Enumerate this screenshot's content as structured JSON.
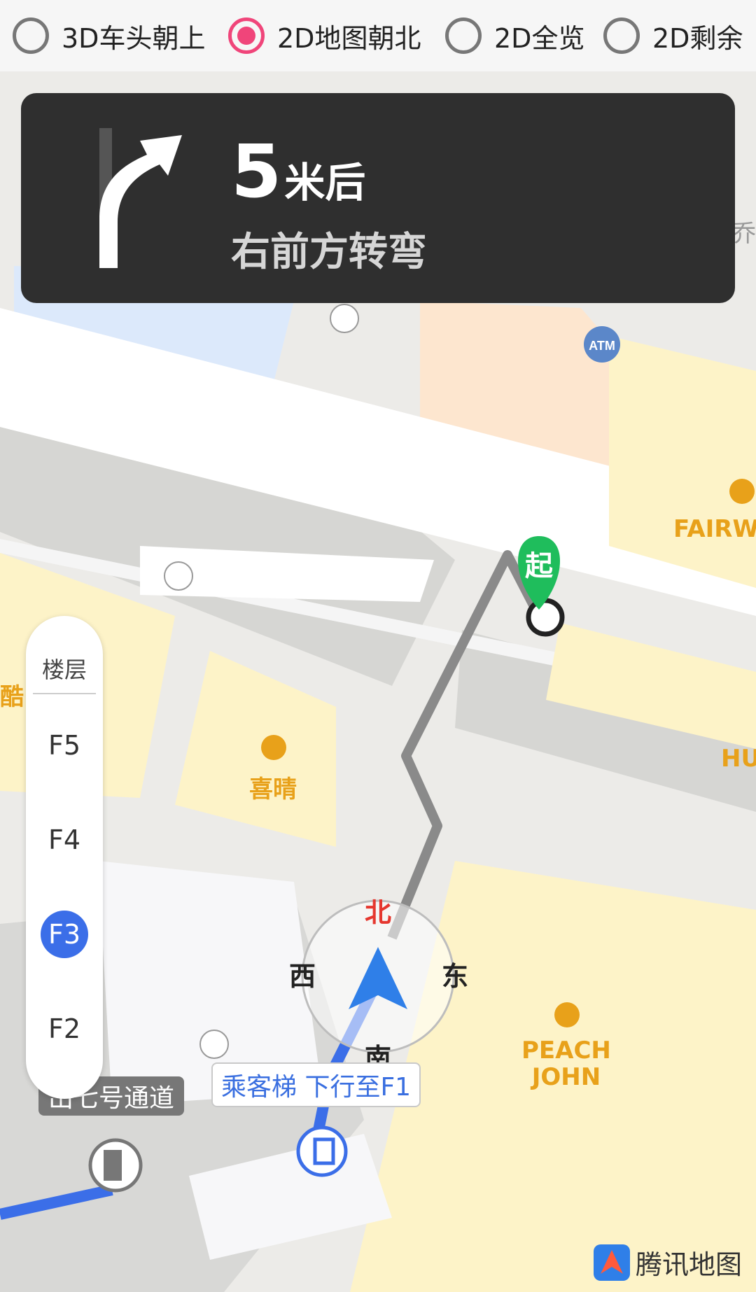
{
  "view_modes": [
    {
      "label": "3D车头朝上",
      "checked": false
    },
    {
      "label": "2D地图朝北",
      "checked": true
    },
    {
      "label": "2D全览",
      "checked": false
    },
    {
      "label": "2D剩余",
      "checked": false
    }
  ],
  "navigation": {
    "distance_value": "5",
    "distance_unit": "米后",
    "instruction": "右前方转弯",
    "maneuver_icon": "turn-slight-right-arrow-icon"
  },
  "floor_selector": {
    "title": "楼层",
    "floors": [
      "F5",
      "F4",
      "F3",
      "F2"
    ],
    "active": "F3"
  },
  "map": {
    "start_marker": "起",
    "compass": {
      "north": "北",
      "east": "东",
      "south": "南",
      "west": "西"
    },
    "elevator_callout": "乘客梯 下行至F1",
    "exit_callout": "出七号通道",
    "shops": [
      {
        "name": "FAIRWI"
      },
      {
        "name": "喜晴"
      },
      {
        "name": "PEACH\nJOHN"
      },
      {
        "name": "HU"
      }
    ],
    "edge_labels": [
      "酷",
      "乔"
    ],
    "atm_label": "ATM",
    "brand": "腾讯地图"
  },
  "colors": {
    "accent_radio": "#f0457a",
    "route_gray": "#8a8a8a",
    "route_blue": "#3b6ee8",
    "start_green": "#1fbd5c",
    "shop_yellow": "#fdf3c8",
    "shop_orange": "#e8a11a",
    "nav_panel_bg": "#2f2f2f"
  }
}
